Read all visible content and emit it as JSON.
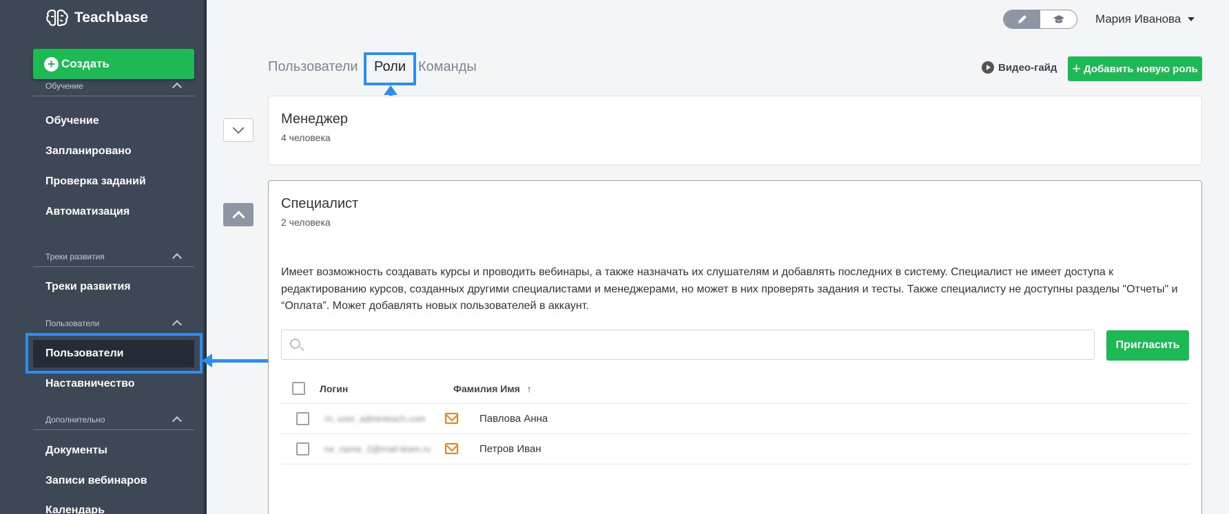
{
  "app": {
    "logo": "Teachbase"
  },
  "sidebar": {
    "create_label": "Создать",
    "sections": [
      {
        "title": "Обучение",
        "items": [
          "Обучение",
          "Запланировано",
          "Проверка заданий",
          "Автоматизация"
        ]
      },
      {
        "title": "Треки развития",
        "items": [
          "Треки развития"
        ]
      },
      {
        "title": "Пользователи",
        "items": [
          "Пользователи",
          "Наставничество"
        ]
      },
      {
        "title": "Дополнительно",
        "items": [
          "Документы",
          "Записи вебинаров",
          "Календарь"
        ]
      }
    ],
    "active_item": "Пользователи"
  },
  "header": {
    "user_name": "Мария Иванова"
  },
  "tabs": [
    {
      "label": "Пользователи",
      "active": false
    },
    {
      "label": "Роли",
      "active": true
    },
    {
      "label": "Команды",
      "active": false
    }
  ],
  "toolbar": {
    "video_guide": "Видео-гайд",
    "add_role": "Добавить новую роль"
  },
  "roles": [
    {
      "title": "Менеджер",
      "count": "4 человека",
      "expanded": false
    },
    {
      "title": "Специалист",
      "count": "2 человека",
      "expanded": true,
      "description": "Имеет возможность создавать курсы и проводить вебинары, а также назначать их слушателям и добавлять последних в систему. Специалист не имеет доступа к редактированию курсов, созданных другими специалистами и менеджерами, но может в них проверять задания и тесты. Также специалисту не доступны разделы \"Отчеты\" и “Оплата”. Может добавлять новых пользователей в аккаунт.",
      "search_placeholder": "",
      "invite_label": "Пригласить",
      "columns": [
        "Логин",
        "Фамилия Имя"
      ],
      "sort_indicator": "↑",
      "users": [
        {
          "login": "rn_user_adminteach.com",
          "name": "Павлова Анна"
        },
        {
          "login": "ne_name_2@mail-team.ru",
          "name": "Петров Иван"
        }
      ]
    }
  ],
  "colors": {
    "accent_green": "#1db954",
    "sidebar_bg": "#3e4756",
    "highlight_blue": "#2f8cf0",
    "mail_orange": "#f07d1a"
  }
}
